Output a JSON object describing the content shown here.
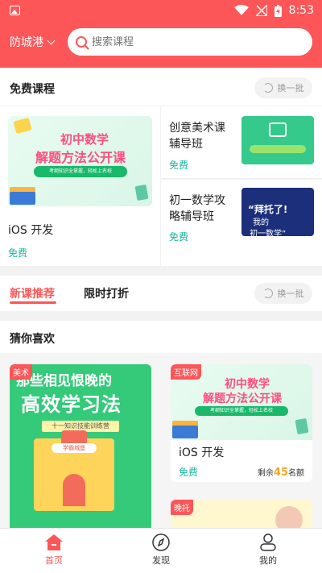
{
  "status": {
    "time": "8:53"
  },
  "header": {
    "city": "防城港",
    "search_placeholder": "搜索课程"
  },
  "free_courses": {
    "title": "免费课程",
    "swap_label": "换一批",
    "featured": {
      "banner_title_1": "初中数学",
      "banner_title_2": "解题方法公开课",
      "banner_sub": "考纲知识全掌握，轻松上名校",
      "name": "iOS 开发",
      "price": "免费"
    },
    "items": [
      {
        "name_1": "创意美术课",
        "name_2": "辅导班",
        "price": "免费"
      },
      {
        "name_1": "初一数学攻",
        "name_2": "略辅导班",
        "price": "免费",
        "thumb_text_1": "“拜托了!",
        "thumb_text_2": "我的",
        "thumb_text_3": "初一数学”"
      }
    ]
  },
  "tabs": [
    {
      "label": "新课推荐"
    },
    {
      "label": "限时打折"
    }
  ],
  "tabs_swap_label": "换一批",
  "guess": {
    "title": "猜你喜欢",
    "big_card": {
      "tag": "美术",
      "line_1": "那些相见恨晚的",
      "line_2": "高效学习法",
      "ribbon": "十一知识技能训练营",
      "sign": "学霸城堡"
    },
    "card_1": {
      "tag": "互联网",
      "banner_title_1": "初中数学",
      "banner_title_2": "解题方法公开课",
      "banner_sub": "考纲知识全掌握，轻松上名校",
      "name": "iOS 开发",
      "price": "免费",
      "remain_prefix": "剩余",
      "remain_count": "45",
      "remain_suffix": "名额"
    },
    "card_2": {
      "tag": "晚托"
    }
  },
  "nav": [
    {
      "label": "首页"
    },
    {
      "label": "发现"
    },
    {
      "label": "我的"
    }
  ],
  "colors": {
    "brand": "#fd5658",
    "free_green": "#19b59f",
    "remain_orange": "#f5a623"
  }
}
